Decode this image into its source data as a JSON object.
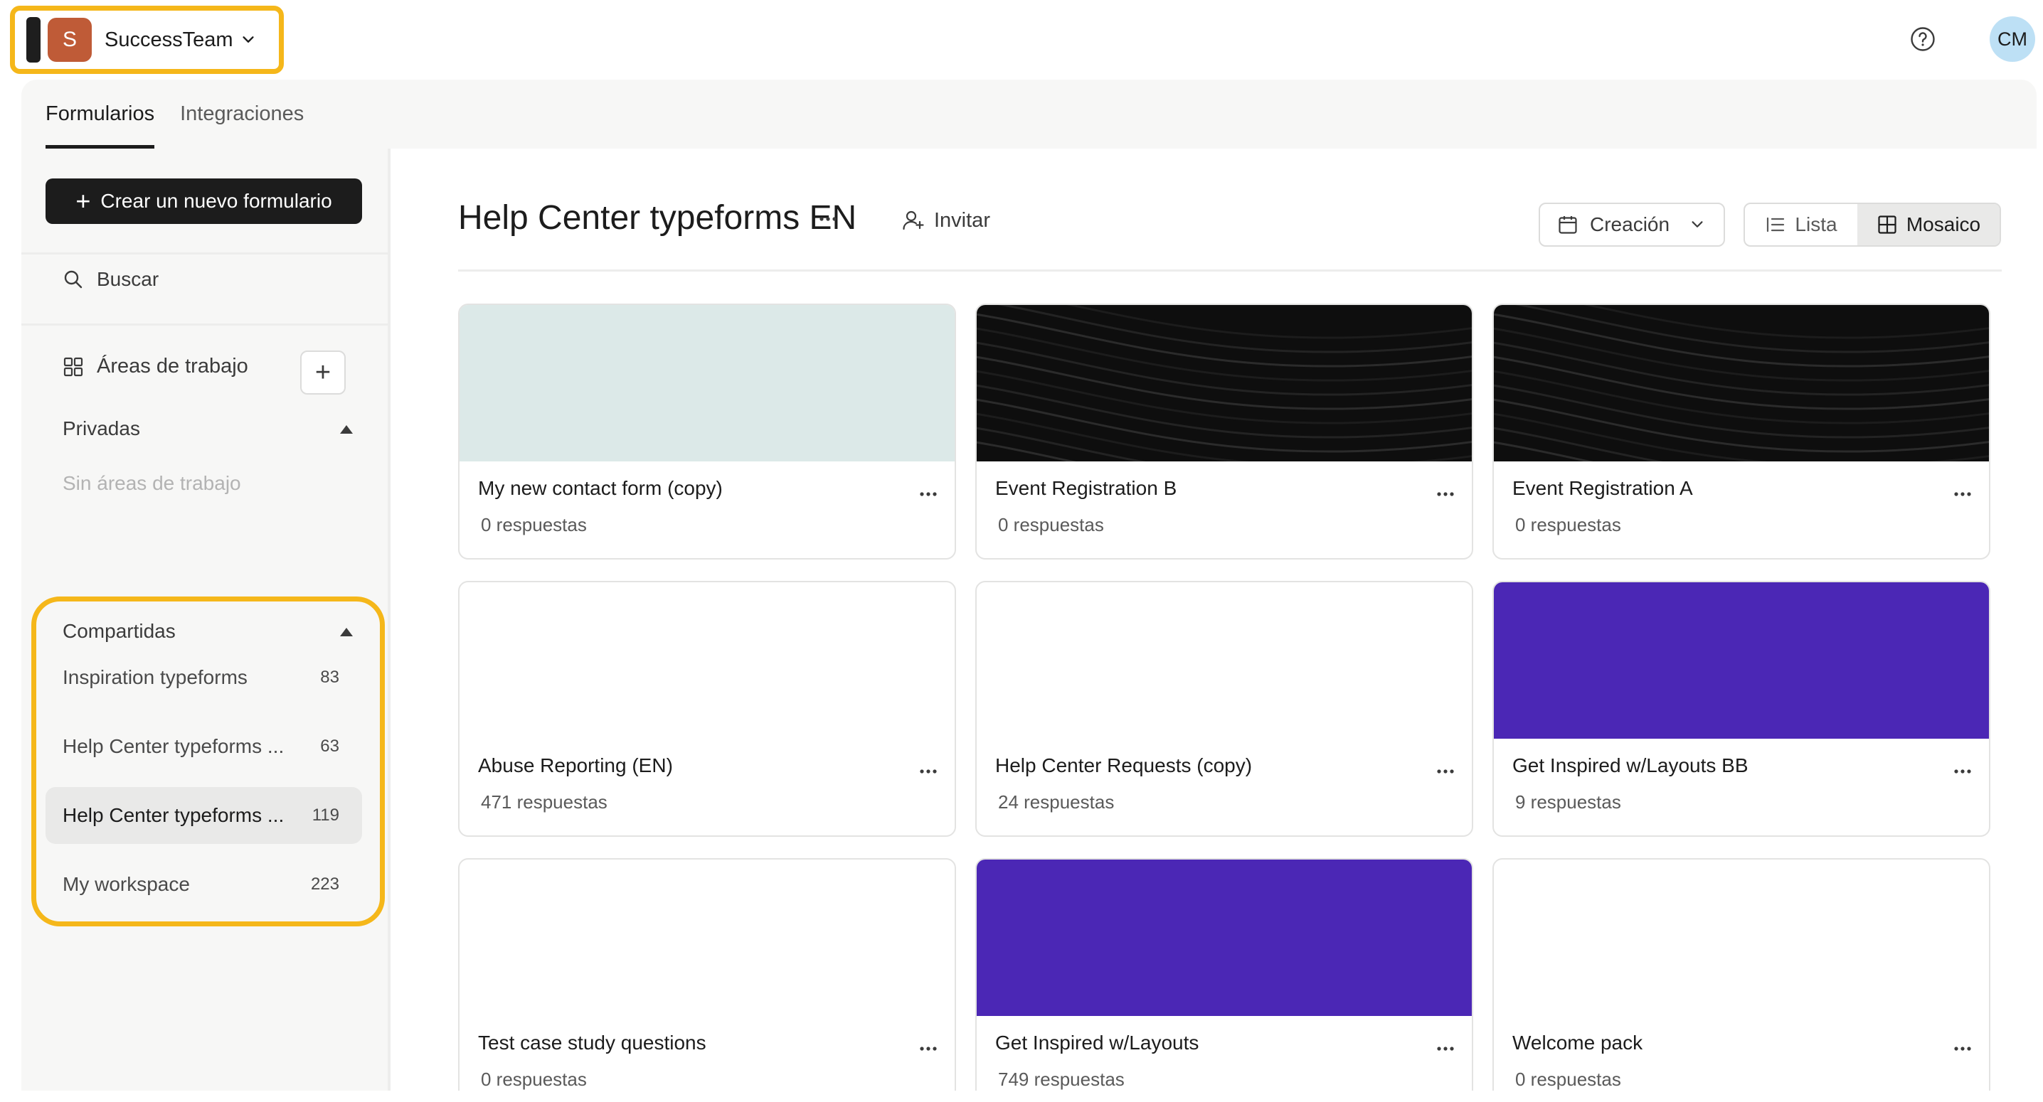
{
  "org": {
    "avatar_letter": "S",
    "name": "SuccessTeam"
  },
  "user": {
    "initials": "CM"
  },
  "tabs": [
    {
      "label": "Formularios",
      "active": true
    },
    {
      "label": "Integraciones",
      "active": false
    }
  ],
  "sidebar": {
    "create_label": "Crear un nuevo formulario",
    "search_label": "Buscar",
    "workspaces_label": "Áreas de trabajo",
    "private": {
      "label": "Privadas",
      "empty": "Sin áreas de trabajo"
    },
    "shared": {
      "label": "Compartidas",
      "items": [
        {
          "label": "Inspiration typeforms",
          "count": "83"
        },
        {
          "label": "Help Center typeforms ...",
          "count": "63"
        },
        {
          "label": "Help Center typeforms ...",
          "count": "119",
          "selected": true
        },
        {
          "label": "My workspace",
          "count": "223"
        }
      ]
    }
  },
  "main": {
    "title": "Help Center typeforms EN",
    "invite_label": "Invitar",
    "sort_label": "Creación",
    "view": {
      "list_label": "Lista",
      "grid_label": "Mosaico",
      "selected": "grid"
    },
    "forms": [
      {
        "title": "My new contact form (copy)",
        "responses": "0 respuestas",
        "thumb": "mint"
      },
      {
        "title": "Event Registration B",
        "responses": "0 respuestas",
        "thumb": "dark"
      },
      {
        "title": "Event Registration A",
        "responses": "0 respuestas",
        "thumb": "dark"
      },
      {
        "title": "Abuse Reporting (EN)",
        "responses": "471 respuestas",
        "thumb": "none"
      },
      {
        "title": "Help Center Requests (copy)",
        "responses": "24 respuestas",
        "thumb": "none"
      },
      {
        "title": "Get Inspired w/Layouts BB",
        "responses": "9 respuestas",
        "thumb": "purple"
      },
      {
        "title": "Test case study questions",
        "responses": "0 respuestas",
        "thumb": "none"
      },
      {
        "title": "Get Inspired w/Layouts",
        "responses": "749 respuestas",
        "thumb": "purple"
      },
      {
        "title": "Welcome pack",
        "responses": "0 respuestas",
        "thumb": "none"
      }
    ]
  },
  "colors": {
    "accent_highlight": "#f5b71a",
    "primary_button": "#1c1c1c",
    "org_avatar": "#bf5b37",
    "user_avatar": "#bde0f5",
    "thumb_mint": "#dce9e8",
    "thumb_purple": "#4b27b5",
    "thumb_dark": "#0e0e0e"
  }
}
